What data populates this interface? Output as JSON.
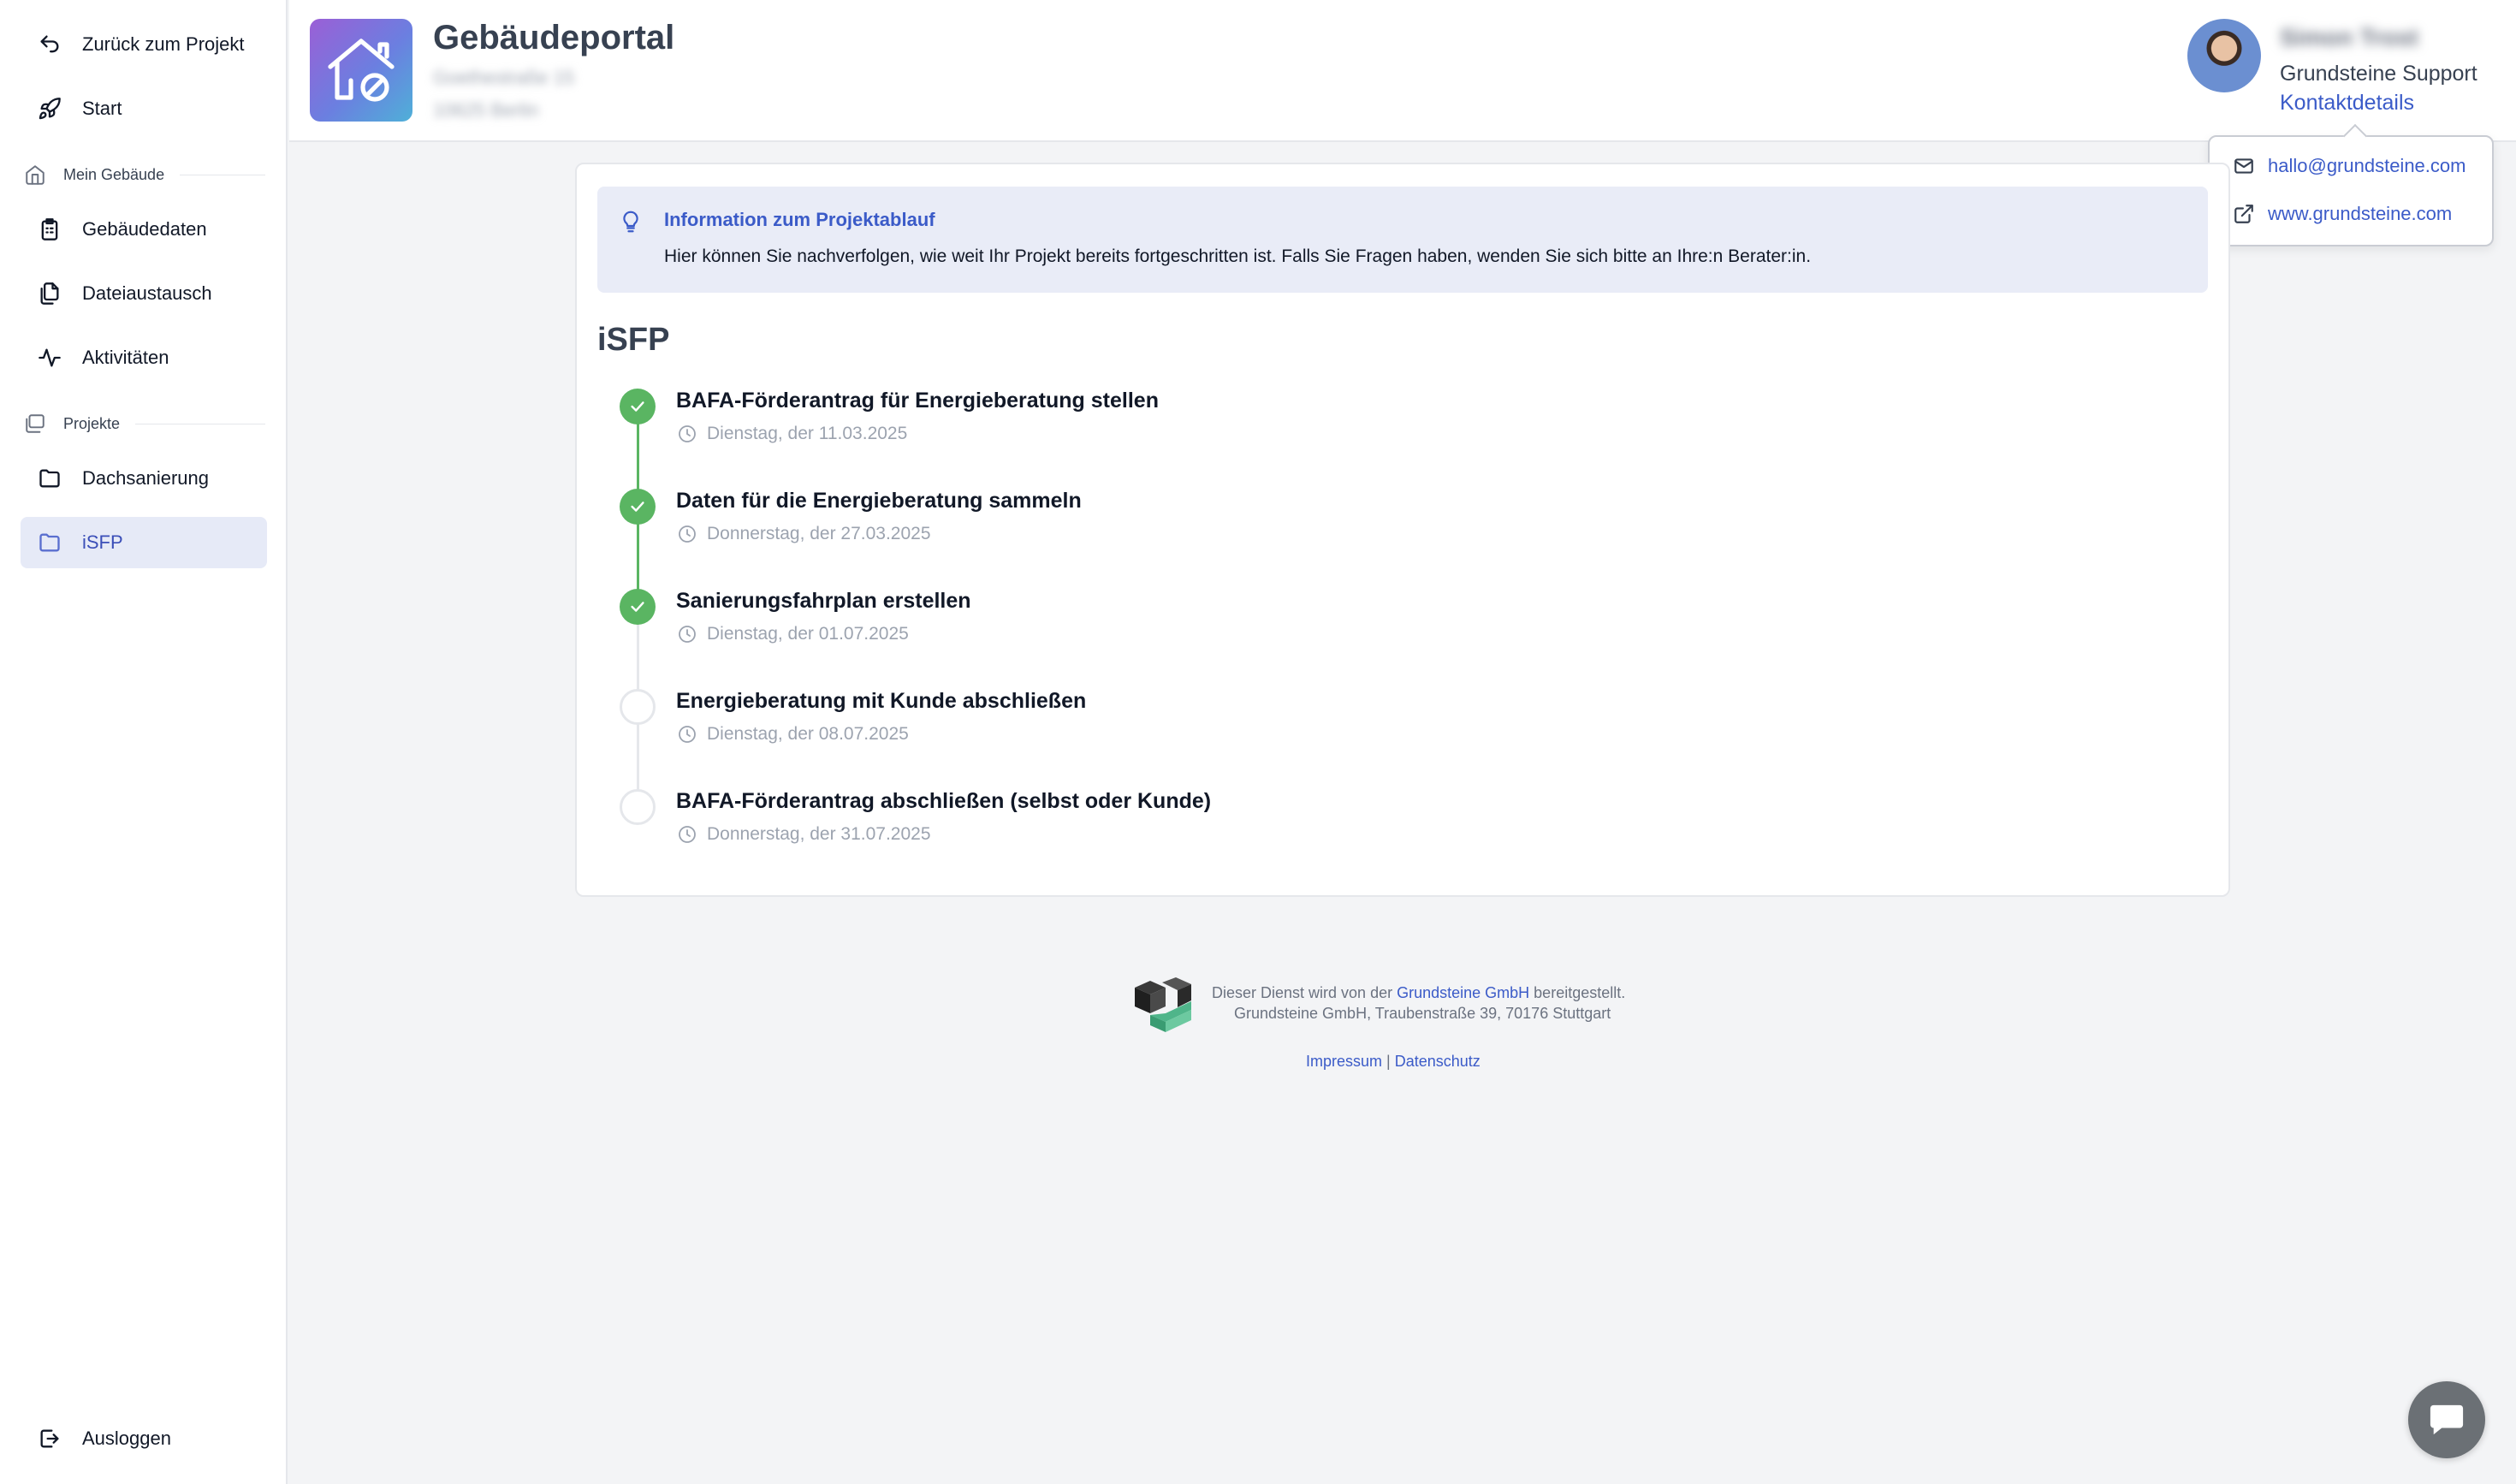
{
  "sidebar": {
    "back_label": "Zurück zum Projekt",
    "start_label": "Start",
    "section_building": "Mein Gebäude",
    "building_items": [
      {
        "label": "Gebäudedaten",
        "icon": "clipboard-icon"
      },
      {
        "label": "Dateiaustausch",
        "icon": "files-icon"
      },
      {
        "label": "Aktivitäten",
        "icon": "activity-icon"
      }
    ],
    "section_projects": "Projekte",
    "project_items": [
      {
        "label": "Dachsanierung",
        "icon": "folder-icon",
        "active": false
      },
      {
        "label": "iSFP",
        "icon": "folder-icon",
        "active": true
      }
    ],
    "logout_label": "Ausloggen"
  },
  "header": {
    "title": "Gebäudeportal",
    "address_line1": "Goethestraße 15",
    "address_line2": "10625 Berlin"
  },
  "support": {
    "name": "Simon Trost",
    "org": "Grundsteine Support",
    "contact_link": "Kontaktdetails",
    "email": "hallo@grundsteine.com",
    "website": "www.grundsteine.com"
  },
  "info": {
    "title": "Information zum Projektablauf",
    "text": "Hier können Sie nachverfolgen, wie weit Ihr Projekt bereits fortgeschritten ist. Falls Sie Fragen haben, wenden Sie sich bitte an Ihre:n Berater:in."
  },
  "project": {
    "title": "iSFP",
    "steps": [
      {
        "title": "BAFA-Förderantrag für Energieberatung stellen",
        "date": "Dienstag, der 11.03.2025",
        "done": true
      },
      {
        "title": "Daten für die Energieberatung sammeln",
        "date": "Donnerstag, der 27.03.2025",
        "done": true
      },
      {
        "title": "Sanierungsfahrplan erstellen",
        "date": "Dienstag, der 01.07.2025",
        "done": true
      },
      {
        "title": "Energieberatung mit Kunde abschließen",
        "date": "Dienstag, der 08.07.2025",
        "done": false
      },
      {
        "title": "BAFA-Förderantrag abschließen (selbst oder Kunde)",
        "date": "Donnerstag, der 31.07.2025",
        "done": false
      }
    ]
  },
  "footer": {
    "line1_pre": "Dieser Dienst wird von der ",
    "line1_link": "Grundsteine GmbH",
    "line1_post": " bereitgestellt.",
    "line2": "Grundsteine GmbH, Traubenstraße 39, 70176 Stuttgart",
    "impressum": "Impressum",
    "separator": " | ",
    "datenschutz": "Datenschutz"
  },
  "colors": {
    "accent": "#3b5bc8",
    "success": "#5ab562",
    "active_bg": "#e6eaf7",
    "info_bg": "#e9ecf7"
  }
}
